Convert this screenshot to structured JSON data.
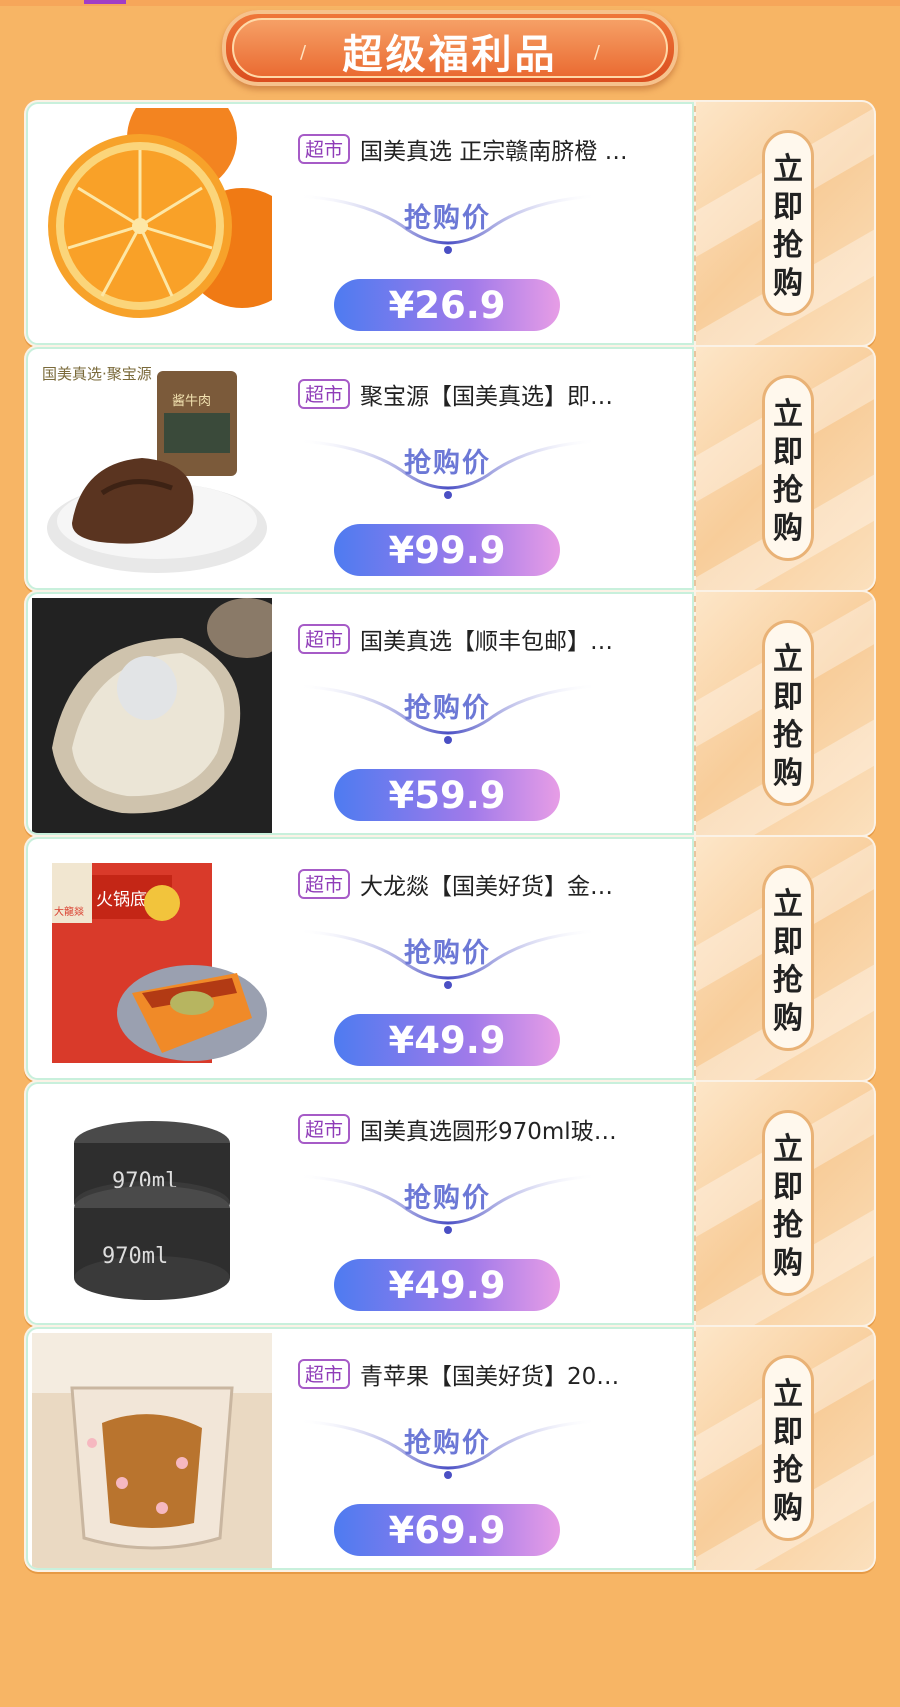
{
  "header": {
    "title": "超级福利品"
  },
  "products": [
    {
      "tag": "超市",
      "title": "国美真选 正宗赣南脐橙 …",
      "price_label": "抢购价",
      "price": "¥26.9",
      "buy_label": "立即抢购",
      "image": "orange"
    },
    {
      "tag": "超市",
      "title": "聚宝源【国美真选】即…",
      "price_label": "抢购价",
      "price": "¥99.9",
      "buy_label": "立即抢购",
      "image": "beef"
    },
    {
      "tag": "超市",
      "title": "国美真选【顺丰包邮】…",
      "price_label": "抢购价",
      "price": "¥59.9",
      "buy_label": "立即抢购",
      "image": "oyster"
    },
    {
      "tag": "超市",
      "title": "大龙燚【国美好货】金…",
      "price_label": "抢购价",
      "price": "¥49.9",
      "buy_label": "立即抢购",
      "image": "hotpot"
    },
    {
      "tag": "超市",
      "title": "国美真选圆形970ml玻…",
      "price_label": "抢购价",
      "price": "¥49.9",
      "buy_label": "立即抢购",
      "image": "glass-box"
    },
    {
      "tag": "超市",
      "title": "青苹果【国美好货】20…",
      "price_label": "抢购价",
      "price": "¥69.9",
      "buy_label": "立即抢购",
      "image": "cat-paw-cup"
    }
  ],
  "image_text": {
    "beef_brand": "国美真选·聚宝源",
    "beef_pack": "酱牛肉",
    "hotpot_brand": "大龍燚",
    "hotpot_pack": "火锅底料",
    "box_capacity": "970ml"
  },
  "colors": {
    "background": "#f7b565",
    "accent": "#8f3cb8",
    "price_start": "#4e7bf0",
    "price_end": "#e79de6"
  }
}
